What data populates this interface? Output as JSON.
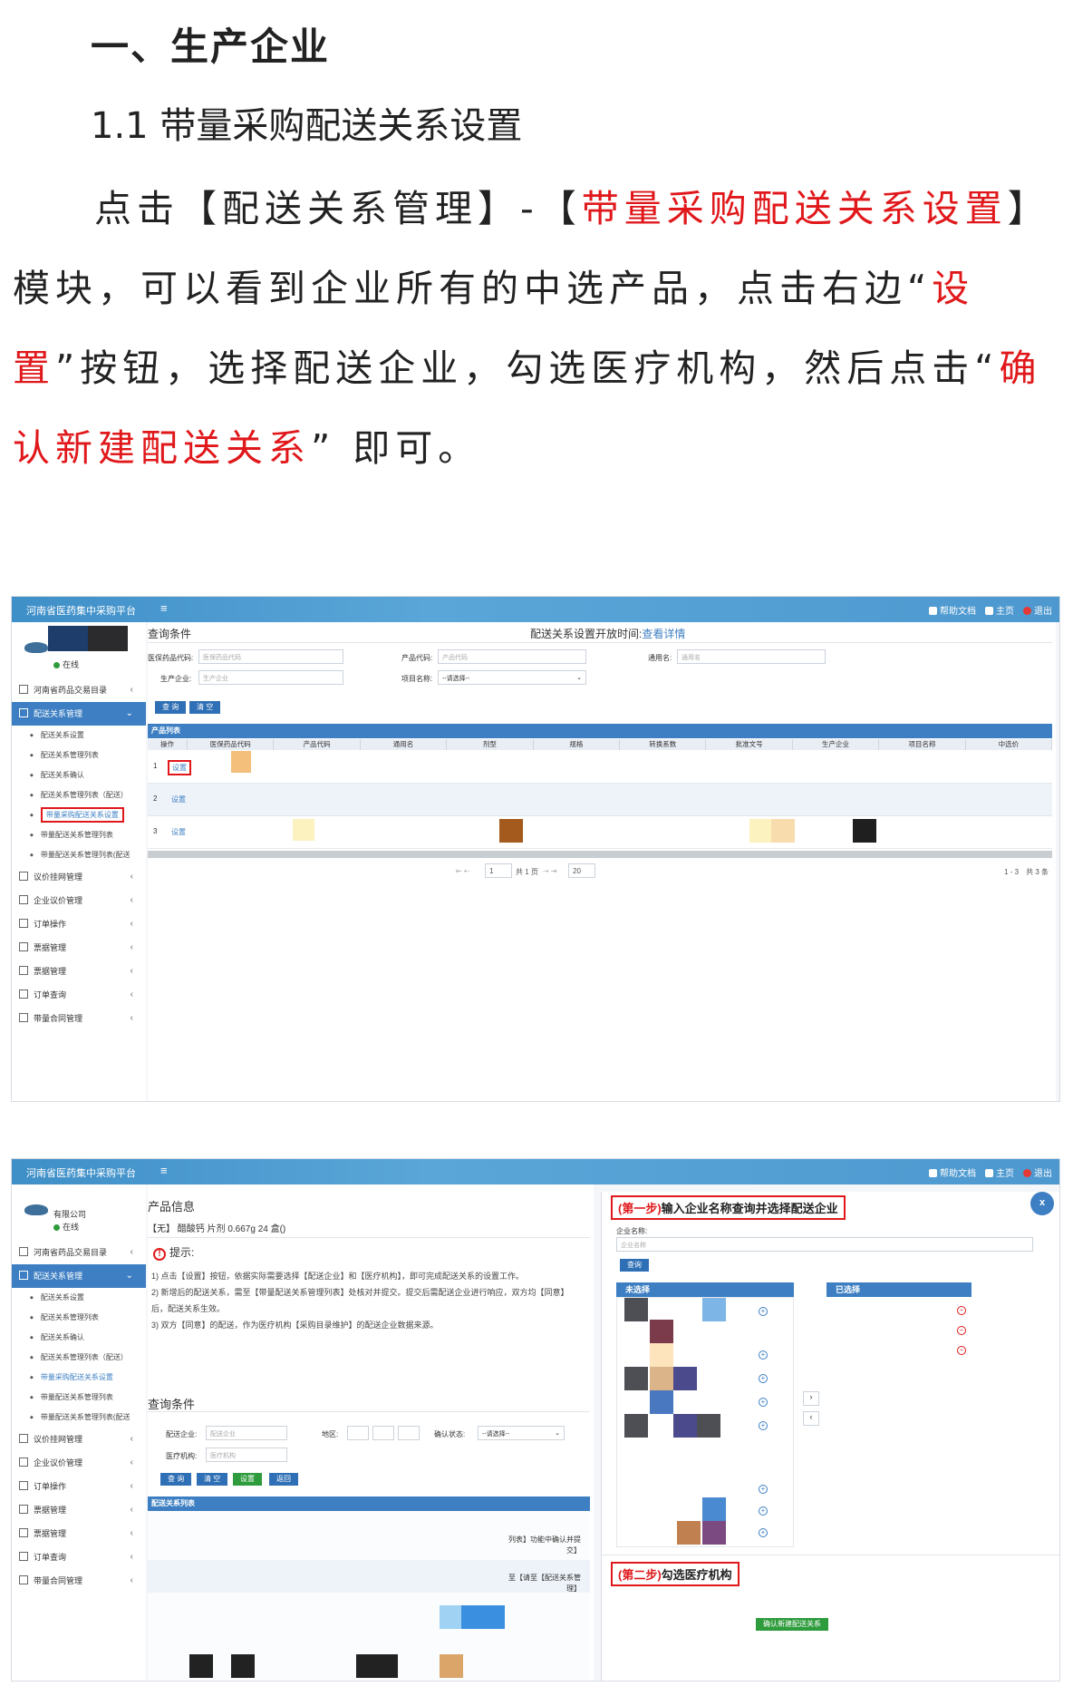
{
  "heading1": "一、生产企业",
  "heading2": "1.1 带量采购配送关系设置",
  "paragraph": {
    "p1": "点击【配送关系管理】-【",
    "p1_red": "带量采购配送关系设置",
    "p2": "】模块，可以看到企业所有的中选产品，点击右边“",
    "p2_red": "设置",
    "p3": "”按钮，选择配送企业，勾选医疗机构，然后点击“",
    "p3_red": "确认新建配送关系",
    "p4": "” 即可。"
  },
  "app": {
    "brand": "河南省医药集中采购平台",
    "menu_icon": "≡",
    "top_right": {
      "help": "帮助文档",
      "home": "主页",
      "logout": "退出"
    },
    "online": "在线",
    "company": "有限公司",
    "sidebar": {
      "catalog": "河南省药品交易目录",
      "delivery_mgmt": "配送关系管理",
      "subs": [
        "配送关系设置",
        "配送关系管理列表",
        "配送关系确认",
        "配送关系管理列表（配送）",
        "带量采购配送关系设置",
        "带量配送关系管理列表",
        "带量配送关系管理列表(配送"
      ],
      "bottom": [
        "议价挂网管理",
        "企业议价管理",
        "订单操作",
        "票据管理",
        "票据管理",
        "订单查询",
        "带量合同管理"
      ]
    }
  },
  "screen1": {
    "query_title": "查询条件",
    "open_time_text": "配送关系设置开放时间:",
    "open_time_link": "查看详情",
    "labels": {
      "code": "医保药品代码:",
      "product_code": "产品代码:",
      "generic": "通用名:",
      "maker": "生产企业:",
      "project": "项目名称:"
    },
    "placeholders": {
      "code": "医保药品代码",
      "product_code": "产品代码",
      "generic": "通用名",
      "maker": "生产企业"
    },
    "project_select": "--请选择--",
    "btn_query": "查 询",
    "btn_clear": "清 空",
    "list_title": "产品列表",
    "columns": [
      "操作",
      "医保药品代码",
      "产品代码",
      "通用名",
      "剂型",
      "规格",
      "转换系数",
      "批准文号",
      "生产企业",
      "项目名称",
      "中选价"
    ],
    "rows": [
      {
        "num": "1",
        "action": "设置"
      },
      {
        "num": "2",
        "action": "设置"
      },
      {
        "num": "3",
        "action": "设置"
      }
    ],
    "pager": {
      "page": "1",
      "of_pages": "共 1 页",
      "per_page": "20",
      "summary": "1 - 3　共 3 条"
    }
  },
  "screen2": {
    "product_info_title": "产品信息",
    "product_name": "【无】 醋酸钙 片剂 0.667g 24 盒()",
    "tip_title": "提示:",
    "tips": [
      "1) 点击【设置】按钮，依据实际需要选择【配送企业】和【医疗机构】，即可完成配送关系的设置工作。",
      "2) 新增后的配送关系，需至【带量配送关系管理列表】处核对并提交。提交后需配送企业进行响应，双方均【同意】后，配送关系生效。",
      "3) 双方【同意】的配送，作为医疗机构【采购目录维护】的配送企业数据来源。"
    ],
    "query_title": "查询条件",
    "labels": {
      "enterprise": "配送企业:",
      "region": "地区:",
      "confirm": "确认状态:",
      "hospital": "医疗机构:"
    },
    "placeholders": {
      "enterprise": "配送企业",
      "hospital": "医疗机构"
    },
    "confirm_select": "--请选择--",
    "buttons": {
      "query": "查 询",
      "clear": "清 空",
      "set": "设置",
      "back": "返回"
    },
    "list_title": "配送关系列表",
    "list_snippets": [
      "列表】功能中确认并提交】",
      "至【请至【配送关系管理】"
    ],
    "step1": {
      "prefix": "(第一步)",
      "text": "输入企业名称查询并选择配送企业"
    },
    "enterprise_name_label": "企业名称:",
    "enterprise_name_placeholder": "企业名称",
    "query_btn": "查询",
    "unselected": "未选择",
    "selected": "已选择",
    "step2": {
      "prefix": "(第二步)",
      "text": "勾选医疗机构"
    },
    "confirm_btn": "确认新建配送关系",
    "close": "x"
  }
}
